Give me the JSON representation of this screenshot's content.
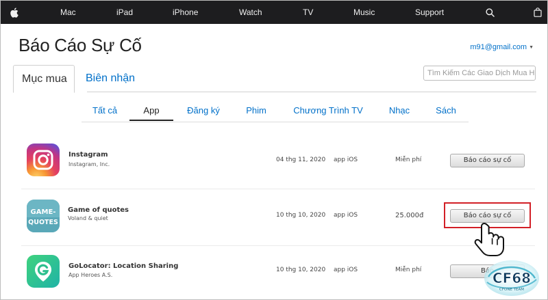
{
  "nav": {
    "items": [
      "Mac",
      "iPad",
      "iPhone",
      "Watch",
      "TV",
      "Music",
      "Support"
    ],
    "icons": [
      "apple-logo-icon",
      "search-icon",
      "bag-icon"
    ]
  },
  "header": {
    "title": "Báo Cáo Sự Cố",
    "account": "m91@gmail.com"
  },
  "main_tabs": {
    "purchases": "Mục mua",
    "receipts": "Biên nhận"
  },
  "search": {
    "placeholder": "Tìm Kiếm Các Giao Dịch Mua H"
  },
  "sub_tabs": [
    "Tất cả",
    "App",
    "Đăng ký",
    "Phim",
    "Chương Trình TV",
    "Nhạc",
    "Sách"
  ],
  "active_sub_tab": "App",
  "rows": [
    {
      "name": "Instagram",
      "developer": "Instagram, Inc.",
      "date": "04 thg 11, 2020",
      "kind": "app iOS",
      "price": "Miễn phí",
      "button": "Báo cáo sự cố"
    },
    {
      "name": "Game of quotes",
      "developer": "Voland & quiet",
      "date": "10 thg 10, 2020",
      "kind": "app iOS",
      "price": "25.000đ",
      "button": "Báo cáo sự cố"
    },
    {
      "name": "GoLocator: Location Sharing",
      "developer": "App Heroes A.S.",
      "date": "10 thg 10, 2020",
      "kind": "app iOS",
      "price": "Miễn phí",
      "button": "Báo"
    }
  ],
  "game_icon_text": [
    "GAME-",
    "QUOTES"
  ],
  "watermark": {
    "logo": "CF68",
    "tagline": "CFONE TEAM"
  },
  "colors": {
    "nav_bg": "#1d1d1f",
    "link": "#0070c9",
    "highlight": "#d21f26"
  }
}
